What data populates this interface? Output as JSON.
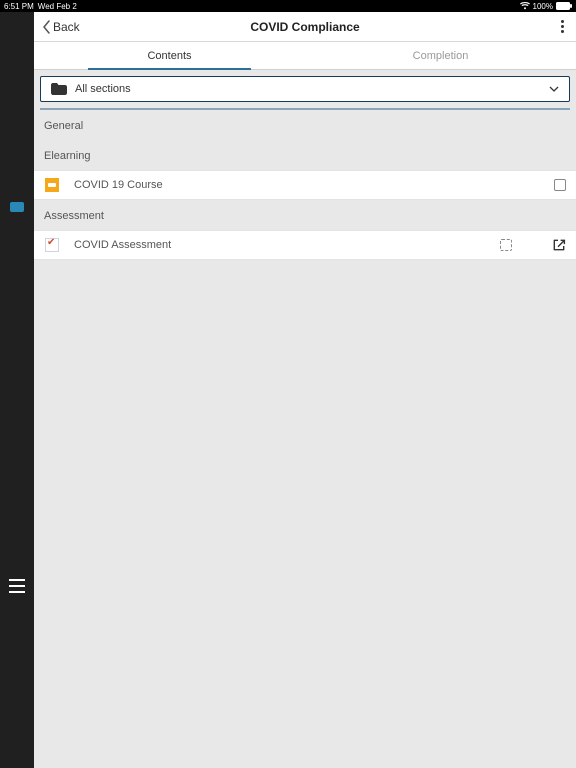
{
  "status": {
    "time": "6:51 PM",
    "date": "Wed Feb 2",
    "battery_pct": "100%"
  },
  "header": {
    "back_label": "Back",
    "title": "COVID Compliance"
  },
  "tabs": {
    "contents": "Contents",
    "completion": "Completion",
    "active": "contents"
  },
  "filter": {
    "label": "All sections"
  },
  "sections": [
    {
      "heading": "General"
    },
    {
      "heading": "Elearning",
      "item": {
        "label": "COVID 19 Course",
        "type": "course",
        "trailing": "checkbox"
      }
    },
    {
      "heading": "Assessment",
      "item": {
        "label": "COVID Assessment",
        "type": "assessment",
        "trailing": "dotted_open"
      }
    }
  ]
}
